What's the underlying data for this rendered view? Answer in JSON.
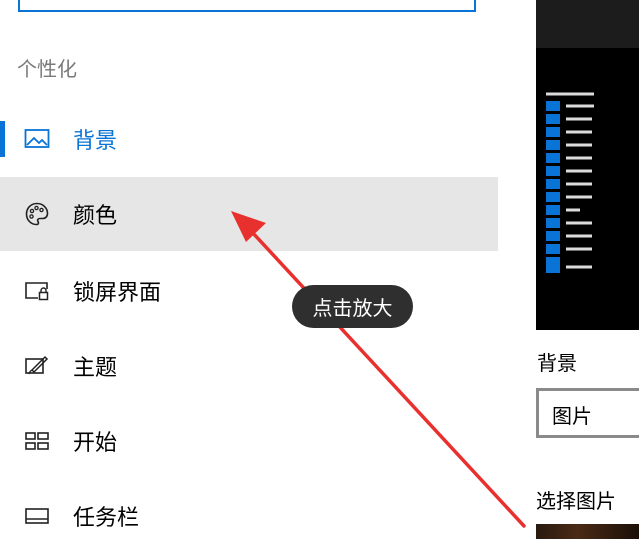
{
  "section_title": "个性化",
  "nav": {
    "items": [
      {
        "label": "背景",
        "icon": "picture-icon",
        "selected": true
      },
      {
        "label": "颜色",
        "icon": "palette-icon",
        "hover": true
      },
      {
        "label": "锁屏界面",
        "icon": "lock-screen-icon"
      },
      {
        "label": "主题",
        "icon": "theme-brush-icon"
      },
      {
        "label": "开始",
        "icon": "start-tiles-icon"
      },
      {
        "label": "任务栏",
        "icon": "taskbar-icon"
      }
    ]
  },
  "right_panel": {
    "background_label": "背景",
    "background_select_value": "图片",
    "choose_picture_label": "选择图片"
  },
  "tooltip": {
    "text": "点击放大"
  },
  "colors": {
    "accent": "#0a74d6",
    "hover_bg": "#e6e6e6",
    "annotation_arrow": "#e8312e",
    "tooltip_bg": "#2f2f2f"
  }
}
